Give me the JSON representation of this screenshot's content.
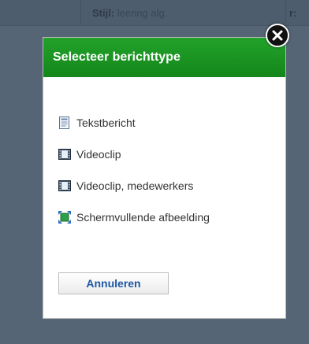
{
  "background": {
    "style_label": "Stijl:",
    "style_value": "leering alg.",
    "clipped_label": "r:"
  },
  "dialog": {
    "title": "Selecteer berichttype",
    "options": [
      {
        "label": "Tekstbericht",
        "icon": "text-document-icon"
      },
      {
        "label": "Videoclip",
        "icon": "video-film-icon"
      },
      {
        "label": "Videoclip, medewerkers",
        "icon": "video-film-icon"
      },
      {
        "label": "Schermvullende afbeelding",
        "icon": "fullscreen-image-icon"
      }
    ],
    "cancel_label": "Annuleren",
    "close_icon": "close-icon",
    "header_color": "#1a9322",
    "link_color": "#1f57a4"
  }
}
